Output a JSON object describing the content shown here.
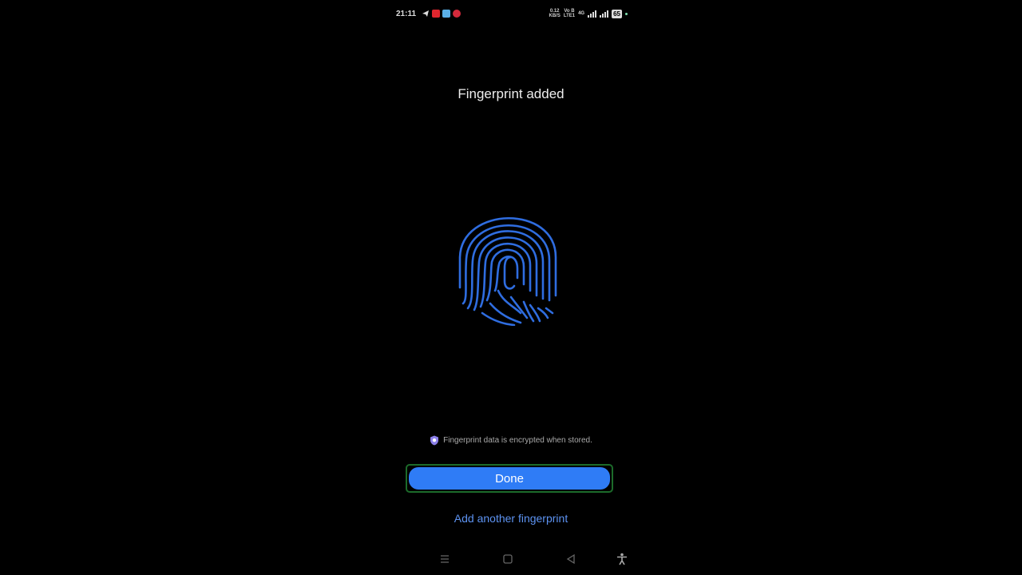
{
  "status_bar": {
    "time": "21:11",
    "net_speed_top": "0.12",
    "net_speed_bottom": "KB/S",
    "volte_top": "Vo B",
    "volte_bottom": "LTE1",
    "sim2_top": "4G",
    "battery": "65",
    "app_icons": [
      "telegram-icon",
      "youtube-icon",
      "app-icon",
      "app-icon"
    ],
    "colors": {
      "youtube": "#e0262e",
      "app_blue": "#5ab0e8",
      "app_red": "#d42a3c"
    }
  },
  "title": "Fingerprint added",
  "fingerprint_icon": "fingerprint-icon",
  "fingerprint_color": "#2f6de0",
  "notice": {
    "icon": "shield-icon",
    "text": "Fingerprint data is encrypted when stored."
  },
  "primary_button": {
    "label": "Done",
    "color": "#2f7cf6"
  },
  "secondary_link": {
    "label": "Add another fingerprint",
    "color": "#5d93f2"
  },
  "nav_bar": {
    "icons": [
      "menu-icon",
      "home-icon",
      "back-icon",
      "accessibility-icon"
    ]
  }
}
